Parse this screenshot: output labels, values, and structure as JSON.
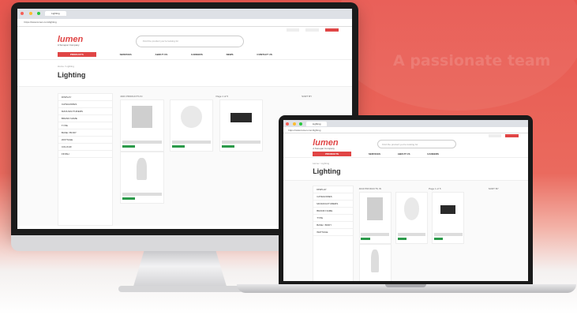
{
  "background_text": "A passionate team",
  "colors": {
    "brand": "#e04545",
    "background": "#e8574f",
    "in_stock": "#2b9a4a"
  },
  "site": {
    "tab_title": "Lighting",
    "url": "https://www.lumen.com/lighting",
    "logo": "lumen",
    "logo_tagline": "A Sonepar Company",
    "search_placeholder": "Find the product you're looking for",
    "nav": [
      "PRODUCTS",
      "SERVICES",
      "ABOUT US",
      "CAREERS",
      "NEWS",
      "CONTACT US"
    ],
    "breadcrumb": "Home / Lighting",
    "page_title": "Lighting",
    "sidebar": [
      "DISPLAY",
      "CATEGORIES",
      "MANUFACTURERS",
      "BRAND NAME",
      "TYPE",
      "BASE / BODY",
      "WATTAGE",
      "COLOUR",
      "FINISH"
    ],
    "results_label": "4043 PRODUCTS IN",
    "pager": "Page 1 of 5",
    "sort": "SORT BY",
    "stock": "In stock"
  }
}
